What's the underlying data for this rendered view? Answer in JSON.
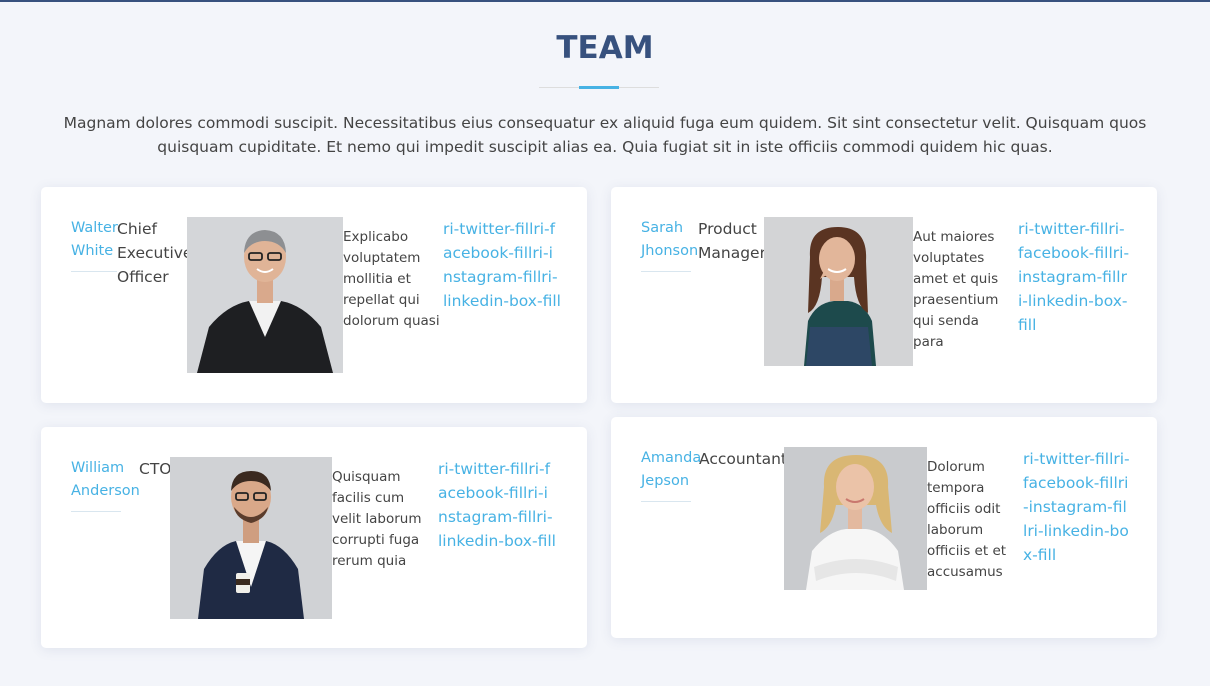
{
  "section": {
    "title": "TEAM",
    "intro": "Magnam dolores commodi suscipit. Necessitatibus eius consequatur ex aliquid fuga eum quidem. Sit sint consectetur velit. Quisquam quos quisquam cupiditate. Et nemo qui impedit suscipit alias ea. Quia fugiat sit in iste officiis commodi quidem hic quas."
  },
  "colors": {
    "title": "#37517e",
    "accent": "#47b2e4",
    "background": "#f3f5fa",
    "card": "#ffffff",
    "text": "#444444"
  },
  "members": [
    {
      "name": "Walter White",
      "role": "Chief Executive Officer",
      "bio": "Explicabo voluptatem mollitia et repellat qui dolorum quasi",
      "social": [
        "ri-twitter-fill",
        "ri-facebook-fill",
        "ri-instagram-fill",
        "ri-linkedin-box-fill"
      ],
      "photo": "portrait-man-gray-hair-black-blazer"
    },
    {
      "name": "Sarah Jhonson",
      "role": "Product Manager",
      "bio": "Aut maiores voluptates amet et quis praesentium qui senda para",
      "social": [
        "ri-twitter-fill",
        "ri-facebook-fill",
        "ri-instagram-fill",
        "ri-linkedin-box-fill"
      ],
      "photo": "portrait-woman-brown-hair-teal-shirt"
    },
    {
      "name": "William Anderson",
      "role": "CTO",
      "bio": "Quisquam facilis cum velit laborum corrupti fuga rerum quia",
      "social": [
        "ri-twitter-fill",
        "ri-facebook-fill",
        "ri-instagram-fill",
        "ri-linkedin-box-fill"
      ],
      "photo": "portrait-man-navy-suit-coffee-cup"
    },
    {
      "name": "Amanda Jepson",
      "role": "Accountant",
      "bio": "Dolorum tempora officiis odit laborum officiis et et accusamus",
      "social": [
        "ri-twitter-fill",
        "ri-facebook-fill",
        "ri-instagram-fill",
        "ri-linkedin-box-fill"
      ],
      "photo": "portrait-woman-blonde-white-blouse"
    }
  ]
}
